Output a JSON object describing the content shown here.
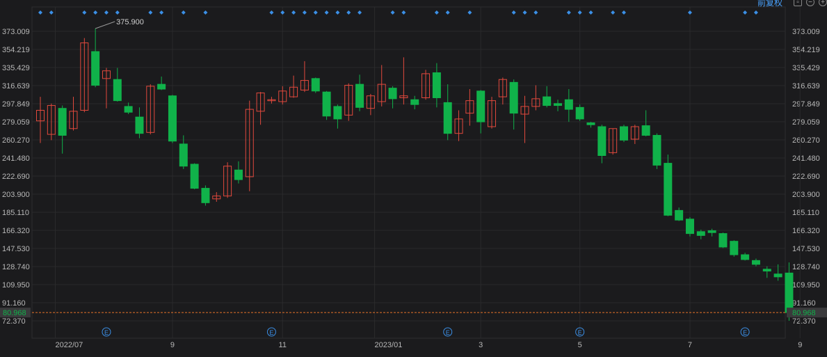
{
  "header": {
    "adjust_label": "前复权",
    "icons": [
      "restore-icon",
      "minimize-icon",
      "add-icon"
    ]
  },
  "colors": {
    "background": "#1b1b1d",
    "up": "#e2493d",
    "down": "#10b24a",
    "grid": "#2a2a2c",
    "axis_text": "#b8b8b8",
    "current_price": "#e8742a",
    "dot_marker": "#3b8fe6",
    "event_marker": "#3b8fe6"
  },
  "chart_data": {
    "type": "candlestick",
    "y_ticks": [
      "373.009",
      "354.219",
      "335.429",
      "316.639",
      "297.849",
      "279.059",
      "260.270",
      "241.480",
      "222.690",
      "203.900",
      "185.110",
      "166.320",
      "147.530",
      "128.740",
      "109.950",
      "91.160",
      "72.370"
    ],
    "ylim": [
      72.37,
      373.009
    ],
    "x_labels": [
      {
        "label": "2022/07",
        "index": 3
      },
      {
        "label": "9",
        "index": 12
      },
      {
        "label": "11",
        "index": 22
      },
      {
        "label": "2023/01",
        "index": 32
      },
      {
        "label": "3",
        "index": 40
      },
      {
        "label": "5",
        "index": 49
      },
      {
        "label": "7",
        "index": 59
      },
      {
        "label": "9",
        "index": 69
      }
    ],
    "current_price": "80.968",
    "max_annotation": {
      "label": "375.900",
      "index": 5
    },
    "min_annotation": {
      "label": "72.370",
      "index": 76
    },
    "event_marker_label": "E",
    "event_markers": [
      6,
      21,
      37,
      49,
      64
    ],
    "dot_markers": [
      0,
      1,
      4,
      5,
      6,
      7,
      10,
      11,
      13,
      15,
      21,
      22,
      23,
      24,
      25,
      26,
      27,
      28,
      29,
      32,
      33,
      36,
      37,
      39,
      43,
      44,
      45,
      48,
      49,
      50,
      52,
      53,
      59,
      64,
      65
    ],
    "candles": [
      {
        "o": 280,
        "h": 305,
        "l": 257,
        "c": 291
      },
      {
        "o": 266,
        "h": 298,
        "l": 260,
        "c": 296
      },
      {
        "o": 293,
        "h": 296,
        "l": 246,
        "c": 265
      },
      {
        "o": 272,
        "h": 305,
        "l": 270,
        "c": 290
      },
      {
        "o": 291,
        "h": 366,
        "l": 289,
        "c": 361
      },
      {
        "o": 352,
        "h": 376,
        "l": 315,
        "c": 317
      },
      {
        "o": 324,
        "h": 335,
        "l": 293,
        "c": 332
      },
      {
        "o": 323,
        "h": 335,
        "l": 300,
        "c": 301
      },
      {
        "o": 295,
        "h": 299,
        "l": 287,
        "c": 289
      },
      {
        "o": 284,
        "h": 294,
        "l": 262,
        "c": 267
      },
      {
        "o": 268,
        "h": 318,
        "l": 266,
        "c": 316
      },
      {
        "o": 318,
        "h": 326,
        "l": 312,
        "c": 313
      },
      {
        "o": 306,
        "h": 307,
        "l": 257,
        "c": 259
      },
      {
        "o": 256,
        "h": 265,
        "l": 230,
        "c": 233
      },
      {
        "o": 235,
        "h": 236,
        "l": 209,
        "c": 210
      },
      {
        "o": 210,
        "h": 213,
        "l": 192,
        "c": 195
      },
      {
        "o": 199,
        "h": 206,
        "l": 196,
        "c": 202
      },
      {
        "o": 202,
        "h": 237,
        "l": 200,
        "c": 233
      },
      {
        "o": 229,
        "h": 238,
        "l": 215,
        "c": 219
      },
      {
        "o": 222,
        "h": 301,
        "l": 207,
        "c": 292
      },
      {
        "o": 290,
        "h": 310,
        "l": 276,
        "c": 309
      },
      {
        "o": 301,
        "h": 305,
        "l": 298,
        "c": 302
      },
      {
        "o": 300,
        "h": 316,
        "l": 297,
        "c": 311
      },
      {
        "o": 305,
        "h": 327,
        "l": 304,
        "c": 315
      },
      {
        "o": 312,
        "h": 342,
        "l": 310,
        "c": 322
      },
      {
        "o": 324,
        "h": 325,
        "l": 309,
        "c": 311
      },
      {
        "o": 310,
        "h": 311,
        "l": 281,
        "c": 285
      },
      {
        "o": 295,
        "h": 297,
        "l": 272,
        "c": 282
      },
      {
        "o": 286,
        "h": 319,
        "l": 280,
        "c": 317
      },
      {
        "o": 318,
        "h": 328,
        "l": 290,
        "c": 294
      },
      {
        "o": 293,
        "h": 308,
        "l": 286,
        "c": 306
      },
      {
        "o": 300,
        "h": 338,
        "l": 295,
        "c": 318
      },
      {
        "o": 314,
        "h": 316,
        "l": 293,
        "c": 303
      },
      {
        "o": 304,
        "h": 346,
        "l": 297,
        "c": 306
      },
      {
        "o": 302,
        "h": 306,
        "l": 292,
        "c": 297
      },
      {
        "o": 304,
        "h": 333,
        "l": 302,
        "c": 329
      },
      {
        "o": 330,
        "h": 340,
        "l": 294,
        "c": 304
      },
      {
        "o": 299,
        "h": 318,
        "l": 260,
        "c": 267
      },
      {
        "o": 267,
        "h": 291,
        "l": 259,
        "c": 282
      },
      {
        "o": 288,
        "h": 313,
        "l": 275,
        "c": 301
      },
      {
        "o": 311,
        "h": 312,
        "l": 267,
        "c": 279
      },
      {
        "o": 274,
        "h": 305,
        "l": 272,
        "c": 301
      },
      {
        "o": 305,
        "h": 325,
        "l": 297,
        "c": 323
      },
      {
        "o": 320,
        "h": 323,
        "l": 271,
        "c": 288
      },
      {
        "o": 287,
        "h": 306,
        "l": 257,
        "c": 295
      },
      {
        "o": 295,
        "h": 317,
        "l": 291,
        "c": 303
      },
      {
        "o": 305,
        "h": 316,
        "l": 294,
        "c": 296
      },
      {
        "o": 298,
        "h": 302,
        "l": 290,
        "c": 296
      },
      {
        "o": 302,
        "h": 313,
        "l": 279,
        "c": 292
      },
      {
        "o": 294,
        "h": 297,
        "l": 280,
        "c": 282
      },
      {
        "o": 278,
        "h": 279,
        "l": 273,
        "c": 276
      },
      {
        "o": 274,
        "h": 276,
        "l": 236,
        "c": 244
      },
      {
        "o": 247,
        "h": 272,
        "l": 245,
        "c": 272
      },
      {
        "o": 274,
        "h": 276,
        "l": 258,
        "c": 260
      },
      {
        "o": 261,
        "h": 276,
        "l": 256,
        "c": 274
      },
      {
        "o": 275,
        "h": 291,
        "l": 264,
        "c": 265
      },
      {
        "o": 265,
        "h": 267,
        "l": 230,
        "c": 234
      },
      {
        "o": 236,
        "h": 245,
        "l": 181,
        "c": 182
      },
      {
        "o": 187,
        "h": 190,
        "l": 176,
        "c": 177
      },
      {
        "o": 178,
        "h": 180,
        "l": 160,
        "c": 163
      },
      {
        "o": 165,
        "h": 167,
        "l": 157,
        "c": 161
      },
      {
        "o": 166,
        "h": 168,
        "l": 160,
        "c": 164
      },
      {
        "o": 163,
        "h": 164,
        "l": 148,
        "c": 149
      },
      {
        "o": 155,
        "h": 156,
        "l": 139,
        "c": 141
      },
      {
        "o": 141,
        "h": 143,
        "l": 135,
        "c": 136
      },
      {
        "o": 135,
        "h": 137,
        "l": 129,
        "c": 131
      },
      {
        "o": 126,
        "h": 129,
        "l": 117,
        "c": 124
      },
      {
        "o": 121,
        "h": 131,
        "l": 114,
        "c": 118
      },
      {
        "o": 122,
        "h": 133,
        "l": 72.37,
        "c": 80.968
      }
    ]
  }
}
